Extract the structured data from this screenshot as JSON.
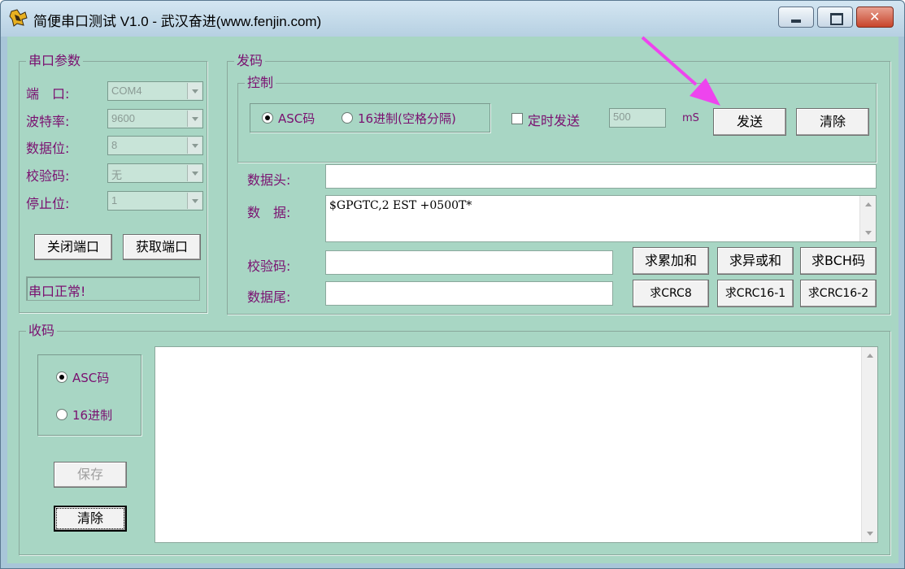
{
  "window": {
    "title": "简便串口测试 V1.0 - 武汉奋进(www.fenjin.com)"
  },
  "serial_params": {
    "group_title": "串口参数",
    "fields": [
      {
        "label": "端　口:",
        "value": "COM4"
      },
      {
        "label": "波特率:",
        "value": "9600"
      },
      {
        "label": "数据位:",
        "value": "8"
      },
      {
        "label": "校验码:",
        "value": "无"
      },
      {
        "label": "停止位:",
        "value": "1"
      }
    ],
    "close_port_label": "关闭端口",
    "get_port_label": "获取端口",
    "status": "串口正常!"
  },
  "send": {
    "group_title": "发码",
    "control": {
      "group_title": "控制",
      "radio_asc_label": "ASC码",
      "radio_hex_label": "16进制(空格分隔)",
      "timed_send_label": "定时发送",
      "interval_value": "500",
      "interval_unit": "mS",
      "send_label": "发送",
      "clear_label": "清除"
    },
    "header_label": "数据头:",
    "header_value": "",
    "data_label": "数　据:",
    "data_value": "$GPGTC,2  EST +0500T*",
    "checksum_label": "校验码:",
    "checksum_value": "",
    "tail_label": "数据尾:",
    "tail_value": "",
    "buttons": {
      "sum": "求累加和",
      "xor": "求异或和",
      "bch": "求BCH码",
      "crc8": "求CRC8",
      "crc16_1": "求CRC16-1",
      "crc16_2": "求CRC16-2"
    }
  },
  "receive": {
    "group_title": "收码",
    "radio_asc_label": "ASC码",
    "radio_hex_label": "16进制",
    "save_label": "保存",
    "clear_label": "清除",
    "received_text": ""
  },
  "colors": {
    "client_bg": "#a8d6c4",
    "label_text": "#7a1070",
    "annotation_arrow": "#ee44ee"
  }
}
